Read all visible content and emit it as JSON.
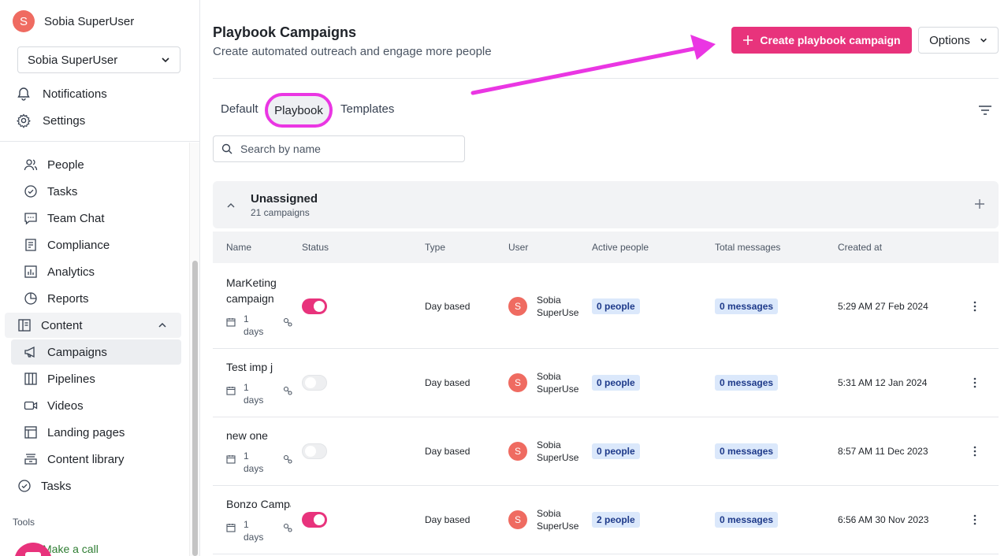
{
  "sidebar": {
    "user": {
      "initial": "S",
      "name": "Sobia SuperUser"
    },
    "account_select": "Sobia SuperUser",
    "notifications": "Notifications",
    "settings": "Settings",
    "items": [
      {
        "label": "People",
        "icon": "people-icon"
      },
      {
        "label": "Tasks",
        "icon": "check-circle-icon"
      },
      {
        "label": "Team Chat",
        "icon": "chat-icon"
      },
      {
        "label": "Compliance",
        "icon": "compliance-icon"
      },
      {
        "label": "Analytics",
        "icon": "analytics-icon"
      },
      {
        "label": "Reports",
        "icon": "pie-chart-icon"
      }
    ],
    "content_group": "Content",
    "content_items": [
      {
        "label": "Campaigns",
        "icon": "megaphone-icon",
        "active": true
      },
      {
        "label": "Pipelines",
        "icon": "columns-icon"
      },
      {
        "label": "Videos",
        "icon": "video-icon"
      },
      {
        "label": "Landing pages",
        "icon": "layout-icon"
      },
      {
        "label": "Content library",
        "icon": "library-icon"
      }
    ],
    "tasks_top": "Tasks",
    "tools_label": "Tools",
    "make_call": "Make a call"
  },
  "header": {
    "title": "Playbook Campaigns",
    "subtitle": "Create automated outreach and engage more people",
    "create_button": "Create playbook campaign",
    "options_button": "Options"
  },
  "tabs": [
    {
      "label": "Default"
    },
    {
      "label": "Playbook",
      "active": true
    },
    {
      "label": "Templates"
    }
  ],
  "search": {
    "placeholder": "Search by name"
  },
  "group": {
    "title": "Unassigned",
    "count": "21 campaigns"
  },
  "table": {
    "columns": [
      "Name",
      "Status",
      "Type",
      "User",
      "Active people",
      "Total messages",
      "Created at"
    ],
    "rows": [
      {
        "name": "MarKeting campaign",
        "days_num": "1",
        "days_unit": "days",
        "status": "on",
        "type": "Day based",
        "user_initial": "S",
        "user_first": "Sobia",
        "user_last": "SuperUser",
        "active_people": "0 people",
        "total_messages": "0 messages",
        "created_at": "5:29 AM 27 Feb 2024"
      },
      {
        "name": "Test imp j",
        "days_num": "1",
        "days_unit": "days",
        "status": "off",
        "type": "Day based",
        "user_initial": "S",
        "user_first": "Sobia",
        "user_last": "SuperUser",
        "active_people": "0 people",
        "total_messages": "0 messages",
        "created_at": "5:31 AM 12 Jan 2024"
      },
      {
        "name": "new one",
        "days_num": "1",
        "days_unit": "days",
        "status": "off",
        "type": "Day based",
        "user_initial": "S",
        "user_first": "Sobia",
        "user_last": "SuperUser",
        "active_people": "0 people",
        "total_messages": "0 messages",
        "created_at": "8:57 AM 11 Dec 2023"
      },
      {
        "name": "Bonzo Campaign",
        "days_num": "1",
        "days_unit": "days",
        "status": "on",
        "type": "Day based",
        "user_initial": "S",
        "user_first": "Sobia",
        "user_last": "SuperUser",
        "active_people": "2 people",
        "total_messages": "0 messages",
        "created_at": "6:56 AM 30 Nov 2023"
      }
    ]
  },
  "colors": {
    "accent": "#e8337c",
    "annotation": "#ea36e3",
    "badge_bg": "#dbe8fb",
    "avatar": "#ef6b61"
  }
}
